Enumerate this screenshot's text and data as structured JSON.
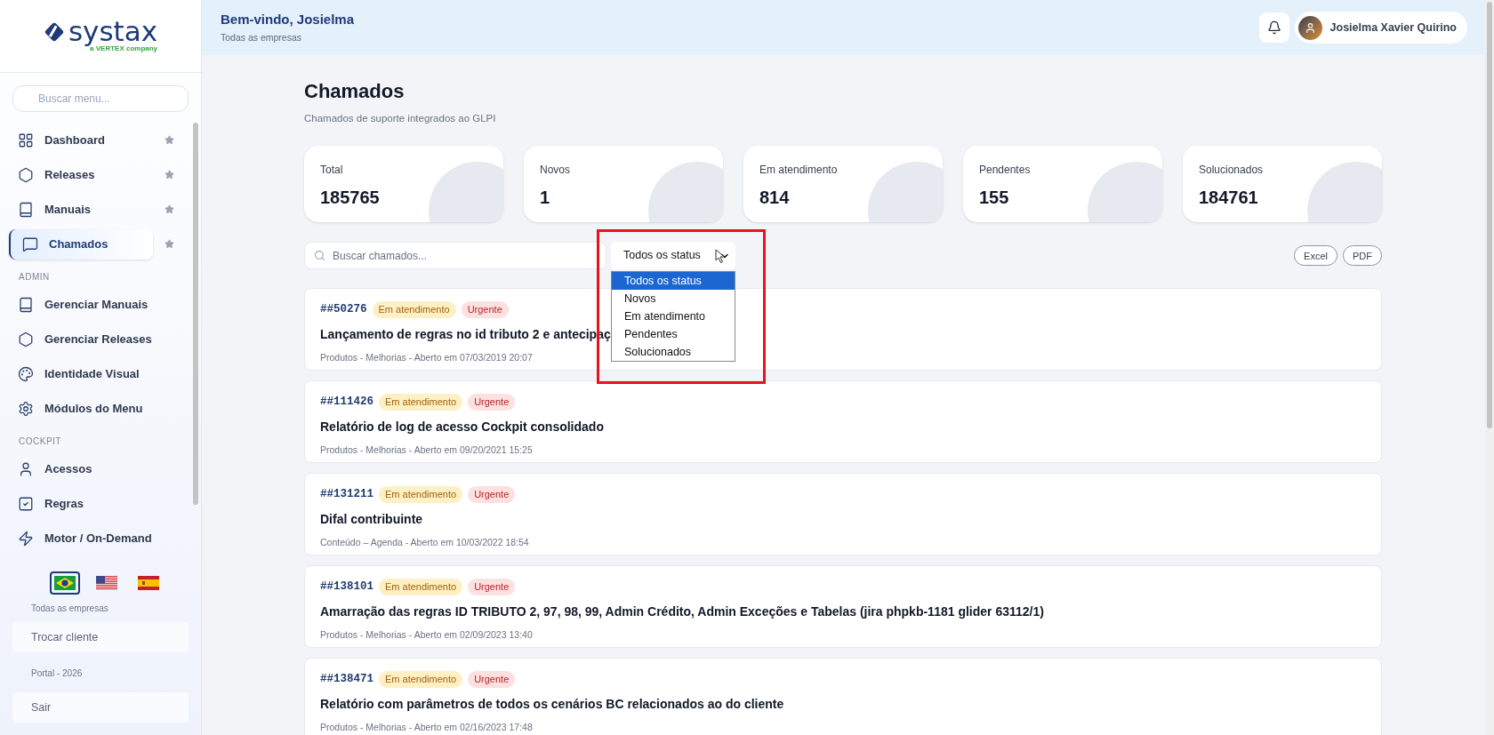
{
  "logo": {
    "name": "systax",
    "tagline": "a VERTEX company"
  },
  "sidebar": {
    "search_placeholder": "Buscar menu...",
    "sections": [
      {
        "items": [
          {
            "label": "Dashboard",
            "selected": false,
            "starred": true
          },
          {
            "label": "Releases",
            "selected": false,
            "starred": true
          },
          {
            "label": "Manuais",
            "selected": false,
            "starred": true
          },
          {
            "label": "Chamados",
            "selected": true,
            "starred": true
          }
        ]
      },
      {
        "heading": "ADMIN",
        "items": [
          {
            "label": "Gerenciar Manuais",
            "selected": false,
            "starred": false
          },
          {
            "label": "Gerenciar Releases",
            "selected": false,
            "starred": false
          },
          {
            "label": "Identidade Visual",
            "selected": false,
            "starred": false
          },
          {
            "label": "Módulos do Menu",
            "selected": false,
            "starred": false
          }
        ]
      },
      {
        "heading": "COCKPIT",
        "items": [
          {
            "label": "Acessos",
            "selected": false,
            "starred": false
          },
          {
            "label": "Regras",
            "selected": false,
            "starred": false
          },
          {
            "label": "Motor / On-Demand",
            "selected": false,
            "starred": false
          }
        ]
      }
    ],
    "languages": [
      {
        "selected": true
      },
      {
        "selected": false
      },
      {
        "selected": false
      }
    ],
    "company": "Todas as empresas",
    "switch_client": "Trocar cliente",
    "version": "Portal - 2026",
    "logout": "Sair"
  },
  "header": {
    "greeting": "Bem-vindo, Josielma",
    "subtitle": "Todas as empresas",
    "user_name": "Josielma Xavier Quirino"
  },
  "page": {
    "title": "Chamados",
    "subtitle": "Chamados de suporte integrados ao GLPI"
  },
  "stats": [
    {
      "label": "Total",
      "value": "185765"
    },
    {
      "label": "Novos",
      "value": "1"
    },
    {
      "label": "Em atendimento",
      "value": "814"
    },
    {
      "label": "Pendentes",
      "value": "155"
    },
    {
      "label": "Solucionados",
      "value": "184761"
    }
  ],
  "filters": {
    "search_placeholder": "Buscar chamados...",
    "status_value": "Todos os status",
    "status_options": [
      {
        "label": "Todos os status",
        "selected": true
      },
      {
        "label": "Novos",
        "selected": false
      },
      {
        "label": "Em atendimento",
        "selected": false
      },
      {
        "label": "Pendentes",
        "selected": false
      },
      {
        "label": "Solucionados",
        "selected": false
      }
    ],
    "export_buttons": [
      "Excel",
      "PDF"
    ]
  },
  "tickets": [
    {
      "id": "##50276",
      "status": "Em atendimento",
      "priority": "Urgente",
      "title": "Lançamento de regras no id tributo 2 e antecipaç",
      "meta": "Produtos - Melhorias - Aberto em 07/03/2019 20:07"
    },
    {
      "id": "##111426",
      "status": "Em atendimento",
      "priority": "Urgente",
      "title": "Relatório de log de acesso Cockpit consolidado",
      "meta": "Produtos - Melhorias - Aberto em 09/20/2021 15:25"
    },
    {
      "id": "##131211",
      "status": "Em atendimento",
      "priority": "Urgente",
      "title": "Difal contribuinte",
      "meta": "Conteúdo – Agenda - Aberto em 10/03/2022 18:54"
    },
    {
      "id": "##138101",
      "status": "Em atendimento",
      "priority": "Urgente",
      "title": "Amarração das regras ID TRIBUTO 2, 97, 98, 99, Admin Crédito, Admin Exceções e Tabelas (jira phpkb-1181 glider 63112/1)",
      "meta": "Produtos - Melhorias - Aberto em 02/09/2023 13:40"
    },
    {
      "id": "##138471",
      "status": "Em atendimento",
      "priority": "Urgente",
      "title": "Relatório com parâmetros de todos os cenários BC relacionados ao do cliente",
      "meta": "Produtos - Melhorias - Aberto em 02/16/2023 17:48"
    }
  ]
}
